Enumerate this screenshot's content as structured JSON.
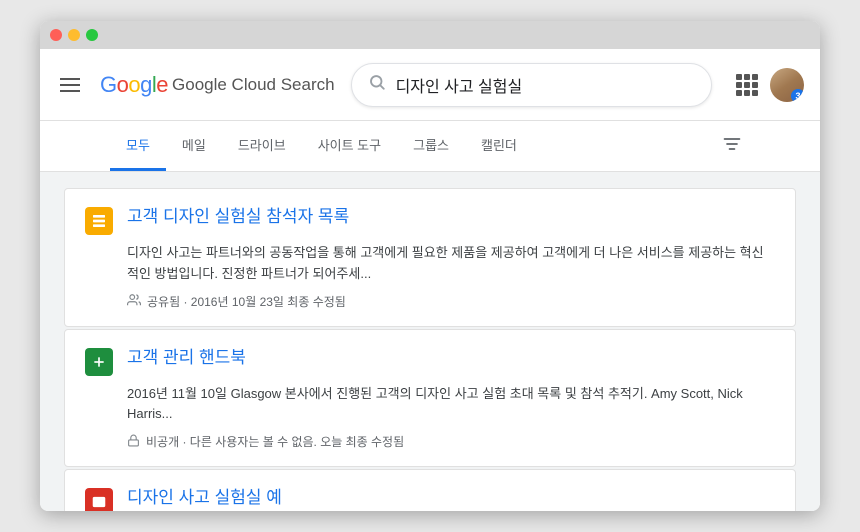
{
  "app": {
    "title": "Google Cloud Search"
  },
  "header": {
    "menu_label": "Menu",
    "logo": {
      "google": "Google",
      "cloud_search": "Cloud Search"
    },
    "search": {
      "query": "디자인 사고 실험실",
      "placeholder": "검색"
    },
    "avatar_badge": "3"
  },
  "tabs": {
    "items": [
      {
        "label": "모두",
        "active": true
      },
      {
        "label": "메일",
        "active": false
      },
      {
        "label": "드라이브",
        "active": false
      },
      {
        "label": "사이트 도구",
        "active": false
      },
      {
        "label": "그룹스",
        "active": false
      },
      {
        "label": "캘린더",
        "active": false
      }
    ]
  },
  "results": [
    {
      "icon_type": "yellow",
      "icon_symbol": "☰",
      "title": "고객 디자인 실험실 참석자 목록",
      "snippet": "디자인 사고는 파트너와의 공동작업을 통해 고객에게 필요한 제품을 제공하여 고객에게 더 나은 서비스를 제공하는 혁신적인 방법입니다. 진정한 파트너가 되어주세...",
      "meta_icon": "people",
      "meta_text": "공유됨 · 2016년 10월 23일 최종 수정됨"
    },
    {
      "icon_type": "green",
      "icon_symbol": "+",
      "title": "고객 관리 핸드북",
      "snippet": "2016년 11월 10일 Glasgow 본사에서 진행된 고객의 디자인 사고 실험 초대 목록 및 참석 추적기. Amy Scott, Nick Harris...",
      "meta_icon": "lock",
      "meta_text": "비공개 · 다른 사용자는 볼 수 없음. 오늘 최종 수정됨"
    },
    {
      "icon_type": "red",
      "icon_symbol": "✉",
      "title": "디자인 사고 실험실 예",
      "snippet": "",
      "meta_icon": "",
      "meta_text": ""
    }
  ]
}
